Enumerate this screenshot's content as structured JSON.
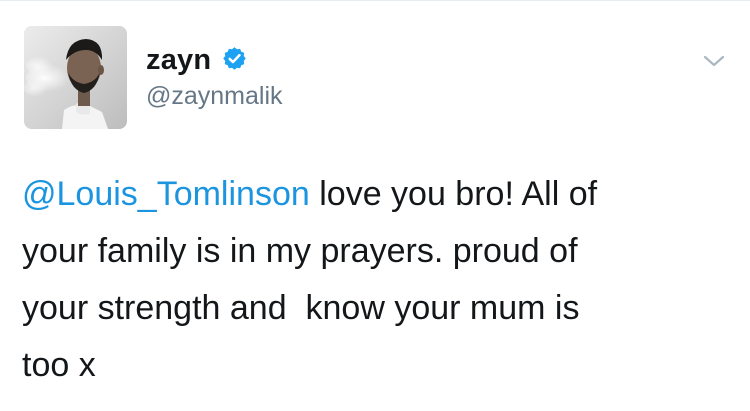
{
  "tweet": {
    "author": {
      "display_name": "zayn",
      "username": "@zaynmalik",
      "verified": true,
      "avatar": "profile-photo"
    },
    "menu_icon": "chevron-down-icon",
    "text": {
      "mention": "@Louis_Tomlinson",
      "line1_rest": " love you bro! All of",
      "line2": "your family is in my prayers. proud of",
      "line3": "your strength and  know your mum is",
      "line4": "too x"
    },
    "colors": {
      "link": "#1b95e0",
      "verified": "#1da1f2",
      "secondary_text": "#657786",
      "primary_text": "#14171a"
    }
  }
}
